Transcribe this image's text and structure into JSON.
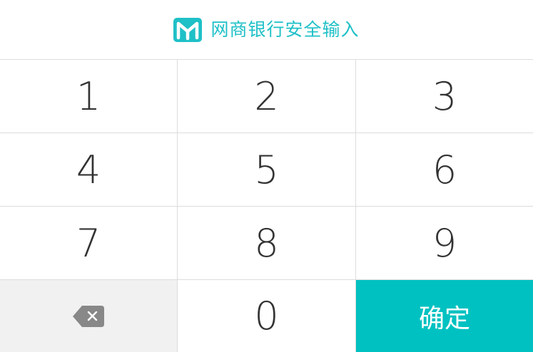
{
  "header": {
    "title": "网商银行安全输入",
    "logo_icon": "mybank-logo-icon",
    "accent_color": "#1fc0c7"
  },
  "keypad": {
    "keys": [
      {
        "label": "1"
      },
      {
        "label": "2"
      },
      {
        "label": "3"
      },
      {
        "label": "4"
      },
      {
        "label": "5"
      },
      {
        "label": "6"
      },
      {
        "label": "7"
      },
      {
        "label": "8"
      },
      {
        "label": "9"
      }
    ],
    "delete_icon": "backspace-icon",
    "zero_label": "0",
    "confirm_label": "确定",
    "confirm_color": "#00c1c1"
  }
}
